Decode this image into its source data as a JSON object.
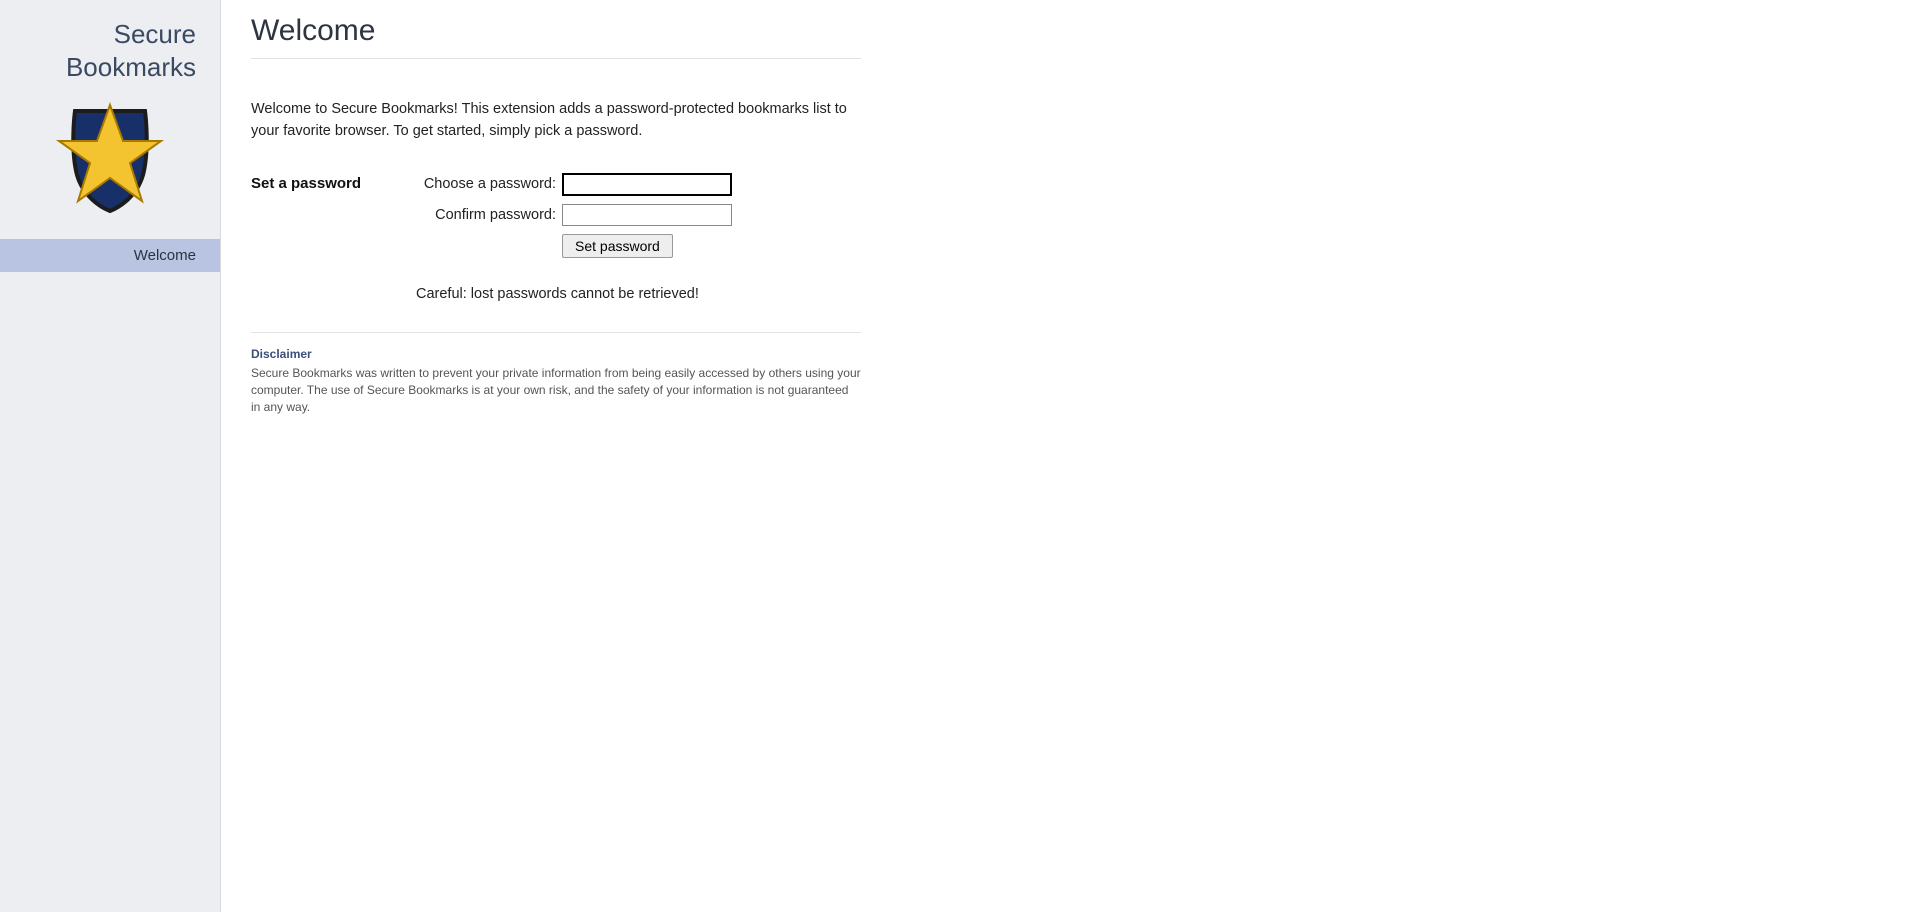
{
  "sidebar": {
    "brand_line1": "Secure",
    "brand_line2": "Bookmarks",
    "nav": [
      {
        "label": "Welcome",
        "active": true
      }
    ]
  },
  "main": {
    "title": "Welcome",
    "intro": "Welcome to Secure Bookmarks! This extension adds a password-protected bookmarks list to your favorite browser. To get started, simply pick a password.",
    "form": {
      "section_label": "Set a password",
      "choose_label": "Choose a password:",
      "confirm_label": "Confirm password:",
      "choose_value": "",
      "confirm_value": "",
      "submit_label": "Set password"
    },
    "warning": "Careful: lost passwords cannot be retrieved!",
    "disclaimer_title": "Disclaimer",
    "disclaimer_text": "Secure Bookmarks was written to prevent your private information from being easily accessed by others using your computer. The use of Secure Bookmarks is at your own risk, and the safety of your information is not guaranteed in any way."
  }
}
